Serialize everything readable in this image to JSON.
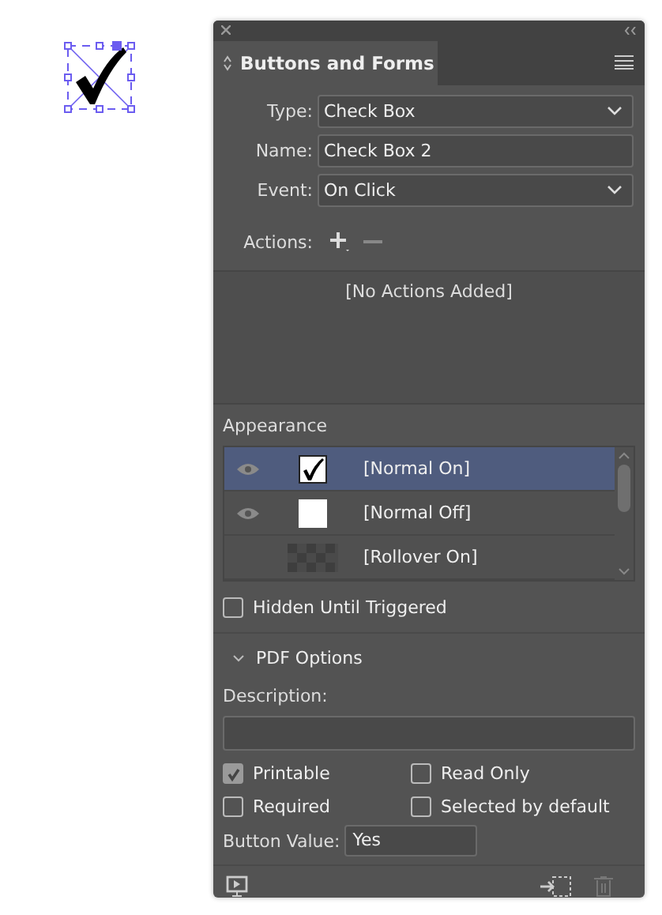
{
  "panel": {
    "title": "Buttons and Forms"
  },
  "fields": [
    {
      "kind": "select",
      "label": "Type:",
      "value": "Check Box"
    },
    {
      "kind": "text",
      "label": "Name:",
      "value": "Check Box 2"
    },
    {
      "kind": "select",
      "label": "Event:",
      "value": "On Click"
    }
  ],
  "actions": {
    "label": "Actions:",
    "empty_text": "[No Actions Added]"
  },
  "appearance": {
    "label": "Appearance",
    "rows": [
      {
        "name": "[Normal On]",
        "selected": true,
        "visible": true,
        "kind": "check"
      },
      {
        "name": "[Normal Off]",
        "selected": false,
        "visible": true,
        "kind": "blank"
      },
      {
        "name": "[Rollover On]",
        "selected": false,
        "visible": false,
        "kind": "transparent"
      }
    ]
  },
  "hidden_until_triggered": {
    "label": "Hidden Until Triggered",
    "checked": false
  },
  "pdf_options": {
    "title": "PDF Options",
    "expanded": true,
    "description_label": "Description:",
    "options": [
      {
        "label": "Printable",
        "checked": true
      },
      {
        "label": "Read Only",
        "checked": false
      },
      {
        "label": "Required",
        "checked": false
      },
      {
        "label": "Selected by default",
        "checked": false
      }
    ],
    "button_value_label": "Button Value:",
    "button_value": "Yes"
  }
}
